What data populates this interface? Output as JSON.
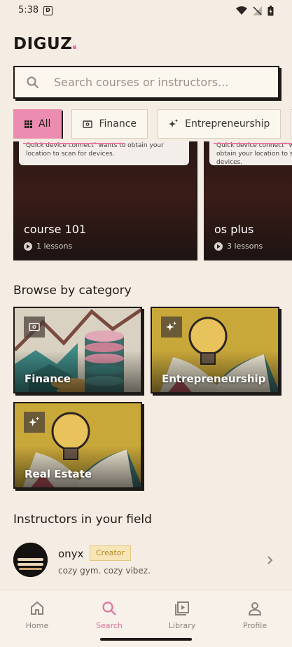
{
  "status_bar": {
    "time": "5:38",
    "sim_badge": "D"
  },
  "header": {
    "logo_text": "DIGUZ",
    "brand_color": "#e97aa7"
  },
  "search": {
    "placeholder": "Search courses or instructors..."
  },
  "filters": [
    {
      "label": "All",
      "icon": "grid-icon",
      "active": true
    },
    {
      "label": "Finance",
      "icon": "money-icon",
      "active": false
    },
    {
      "label": "Entrepreneurship",
      "icon": "sparkle-icon",
      "active": false
    }
  ],
  "courses": [
    {
      "title": "course 101",
      "lessons": "1 lessons",
      "dialog_text": "Quick device connect\" wants to obtain your location to scan for devices."
    },
    {
      "title": "os plus",
      "lessons": "3 lessons",
      "dialog_text": "Quick device connect\" wants to obtain your location to scan for devices."
    }
  ],
  "categories_section": {
    "title": "Browse by category"
  },
  "categories": [
    {
      "label": "Finance",
      "icon": "money-icon"
    },
    {
      "label": "Entrepreneurship",
      "icon": "sparkle-icon"
    },
    {
      "label": "Real Estate",
      "icon": "sparkle-icon"
    }
  ],
  "instructors_section": {
    "title": "Instructors in your field"
  },
  "instructors": [
    {
      "name": "onyx",
      "role": "Creator",
      "bio": "cozy gym. cozy vibez."
    }
  ],
  "bottom_nav": [
    {
      "label": "Home",
      "icon": "home-icon",
      "active": false
    },
    {
      "label": "Search",
      "icon": "search-icon",
      "active": true
    },
    {
      "label": "Library",
      "icon": "library-icon",
      "active": false
    },
    {
      "label": "Profile",
      "icon": "profile-icon",
      "active": false
    }
  ],
  "colors": {
    "background": "#f5ede3",
    "accent": "#ec8cb0",
    "active_nav": "#e2709b"
  }
}
